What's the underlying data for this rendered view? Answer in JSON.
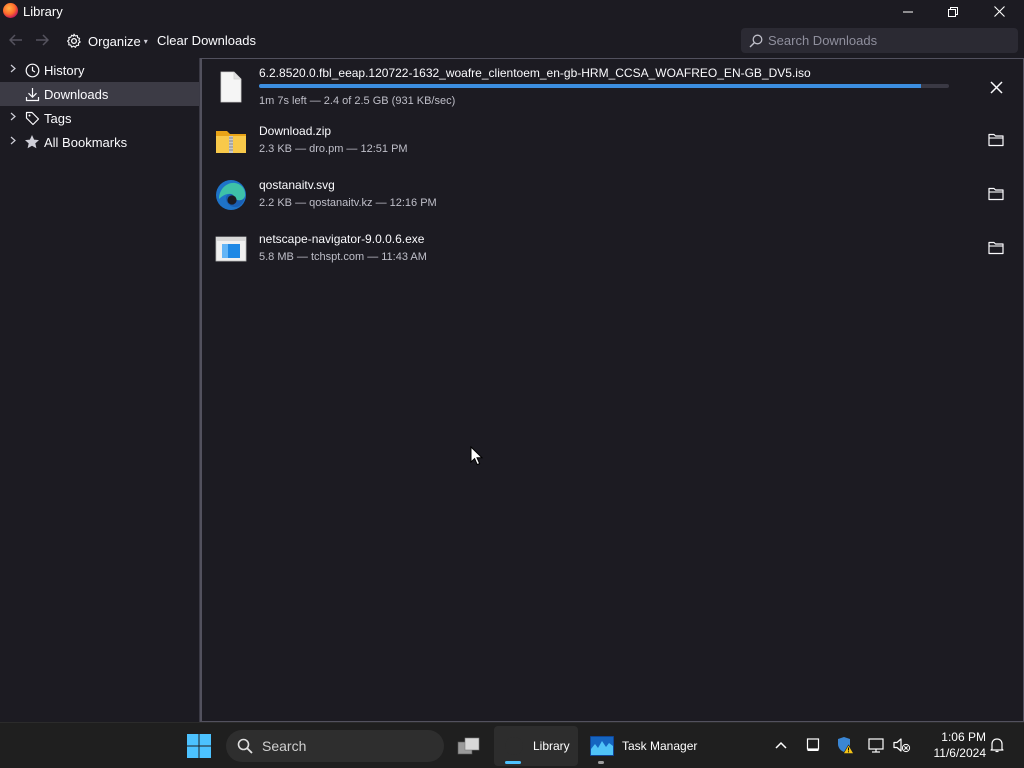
{
  "window": {
    "title": "Library"
  },
  "toolbar": {
    "organize_label": "Organize",
    "clear_downloads_label": "Clear Downloads",
    "search_placeholder": "Search Downloads"
  },
  "sidebar": {
    "items": [
      {
        "label": "History",
        "icon": "clock-icon",
        "expandable": true,
        "selected": false
      },
      {
        "label": "Downloads",
        "icon": "download-icon",
        "expandable": false,
        "selected": true
      },
      {
        "label": "Tags",
        "icon": "tag-icon",
        "expandable": true,
        "selected": false
      },
      {
        "label": "All Bookmarks",
        "icon": "star-icon",
        "expandable": true,
        "selected": false
      }
    ]
  },
  "downloads": [
    {
      "name": "6.2.8520.0.fbl_eeap.120722-1632_woafre_clientoem_en-gb-HRM_CCSA_WOAFREO_EN-GB_DV5.iso",
      "status": "1m 7s left — 2.4 of 2.5 GB (931 KB/sec)",
      "icon": "file-icon",
      "in_progress": true,
      "progress": 0.96,
      "action": "cancel"
    },
    {
      "name": "Download.zip",
      "status": "2.3 KB — dro.pm — 12:51 PM",
      "icon": "zip-folder-icon",
      "in_progress": false,
      "action": "open-folder"
    },
    {
      "name": "qostanaitv.svg",
      "status": "2.2 KB — qostanaitv.kz — 12:16 PM",
      "icon": "edge-icon",
      "in_progress": false,
      "action": "open-folder"
    },
    {
      "name": "netscape-navigator-9.0.0.6.exe",
      "status": "5.8 MB — tchspt.com — 11:43 AM",
      "icon": "exe-icon",
      "in_progress": false,
      "action": "open-folder"
    }
  ],
  "taskbar": {
    "search_label": "Search",
    "apps": [
      {
        "label": "Library",
        "icon": "firefox-icon",
        "active": true
      },
      {
        "label": "Task Manager",
        "icon": "task-manager-icon",
        "active": false
      }
    ],
    "clock_time": "1:06 PM",
    "clock_date": "11/6/2024"
  },
  "colors": {
    "background": "#1c1b22",
    "progress": "#3c8ee0",
    "selected": "#3c3b45",
    "taskbar": "#1f1f1f",
    "accent": "#4cc2ff"
  }
}
